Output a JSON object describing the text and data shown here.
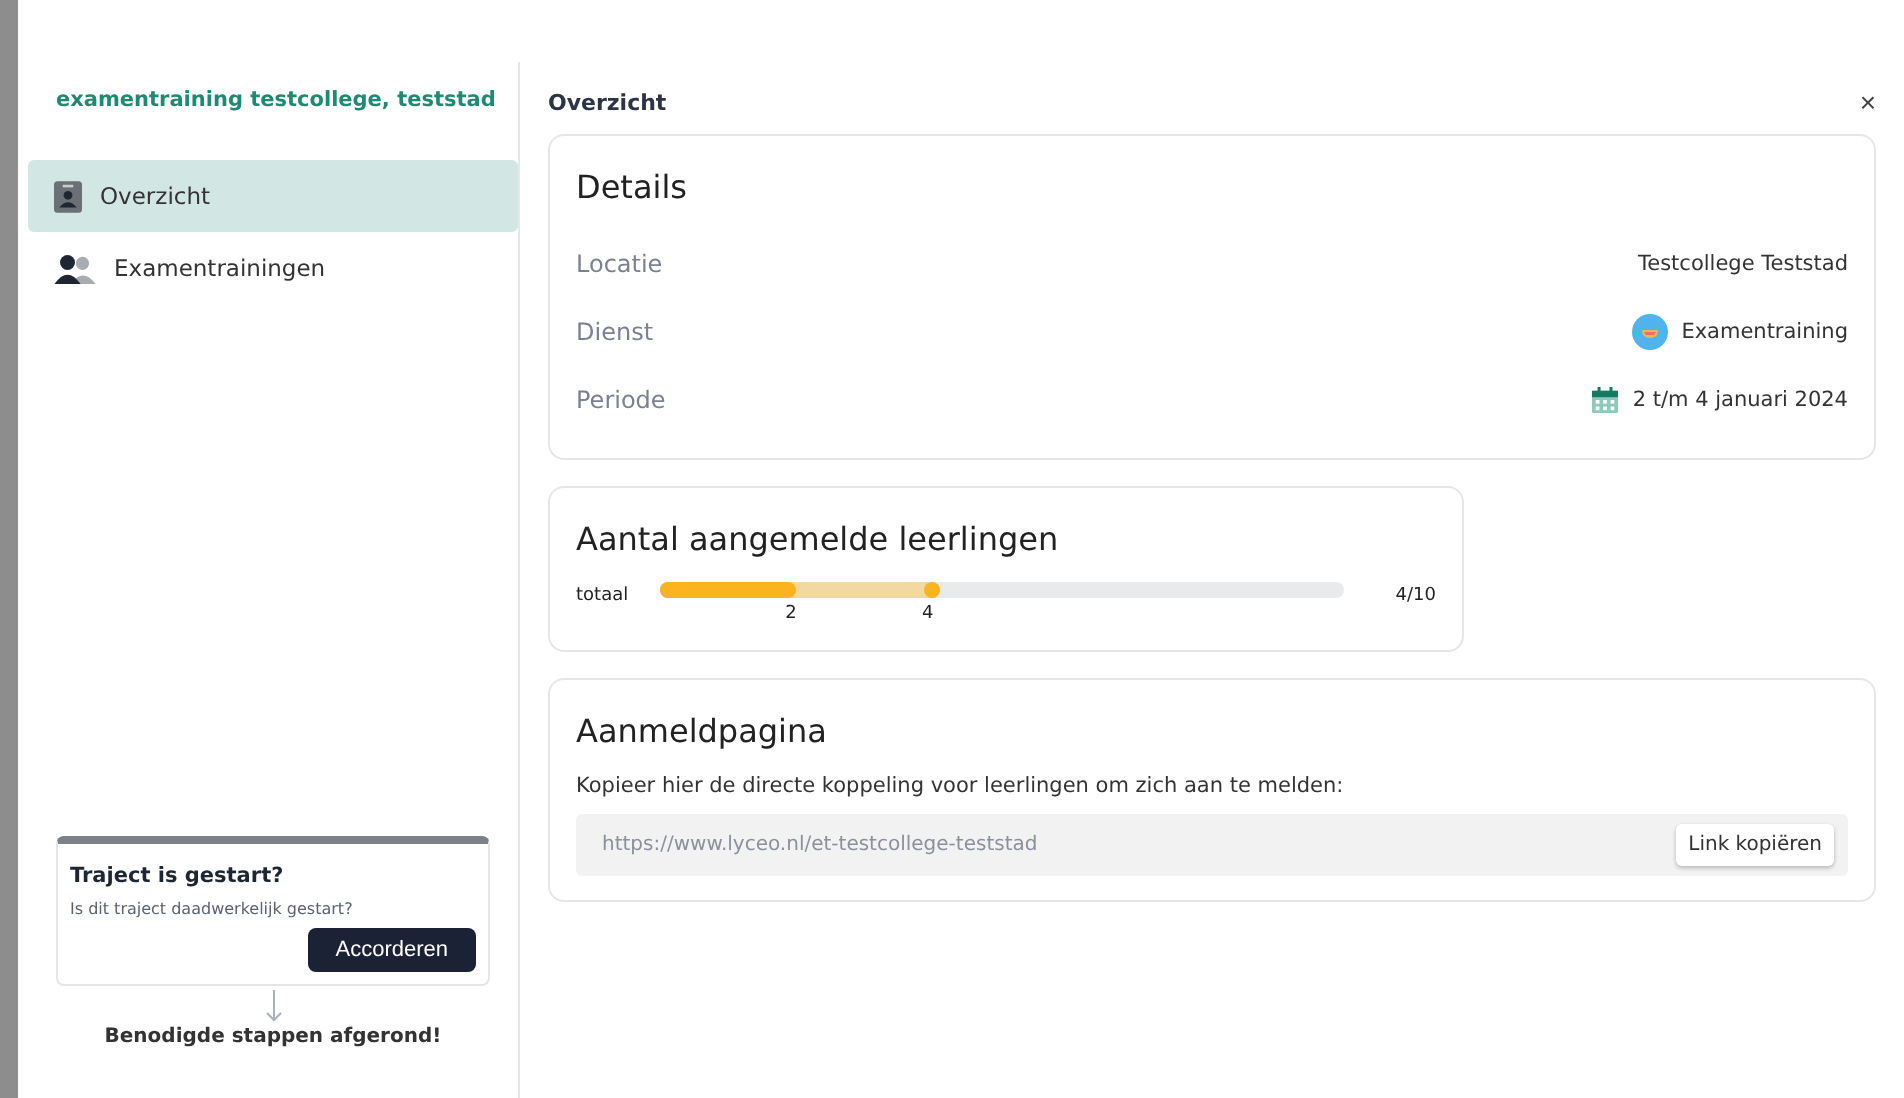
{
  "sidebar": {
    "title": "examentraining testcollege, teststad",
    "items": [
      {
        "label": "Overzicht",
        "kind": "overview",
        "selected": true
      },
      {
        "label": "Examentrainingen",
        "kind": "trainings",
        "selected": false
      }
    ],
    "task_card": {
      "title": "Traject is gestart?",
      "text": "Is dit traject daadwerkelijk gestart?",
      "button": "Accorderen"
    },
    "footer": "Benodigde stappen afgerond!"
  },
  "header": {
    "title": "Overzicht",
    "close": "×"
  },
  "details": {
    "title": "Details",
    "rows": [
      {
        "label": "Locatie",
        "value": "Testcollege Teststad",
        "kind": "location"
      },
      {
        "label": "Dienst",
        "value": "Examentraining",
        "kind": "service"
      },
      {
        "label": "Periode",
        "value": "2 t/m 4 januari 2024",
        "kind": "period"
      }
    ]
  },
  "enrolled": {
    "title": "Aantal aangemelde leerlingen",
    "label": "totaal",
    "reading": "4/10",
    "segments": [
      {
        "kind": "confirmed",
        "level": 0.2,
        "label": "2"
      },
      {
        "kind": "pending",
        "level": 0.4,
        "label": "4"
      }
    ]
  },
  "signup": {
    "title": "Aanmeldpagina",
    "text": "Kopieer hier de directe koppeling voor leerlingen om zich aan te melden:",
    "url": "https://www.lyceo.nl/et-testcollege-teststad",
    "button": "Link kopiëren"
  }
}
